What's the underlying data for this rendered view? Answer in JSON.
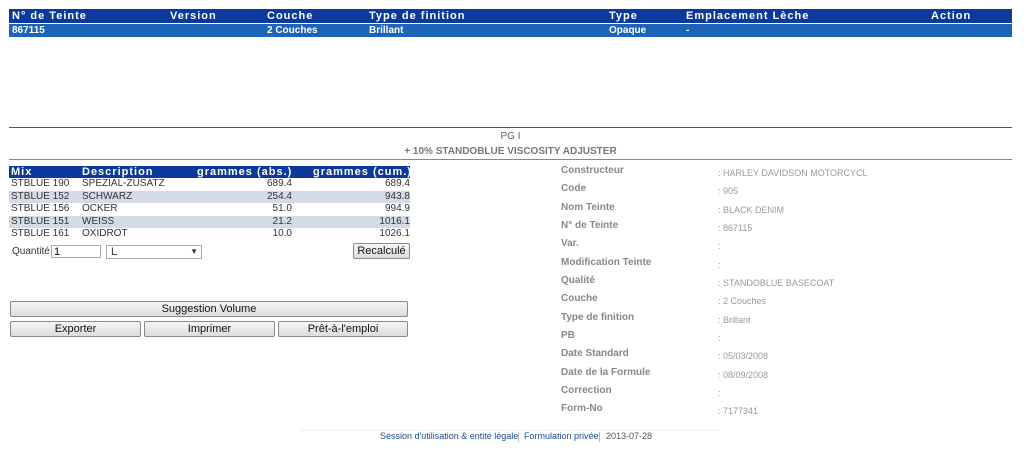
{
  "top_table": {
    "headers": [
      "N° de Teinte",
      "Version",
      "Couche",
      "Type de finition",
      "Type",
      "Emplacement Lèche",
      "Action"
    ],
    "row": {
      "teinte": "867115",
      "version": "",
      "couche": "2 Couches",
      "finition": "Brillant",
      "type": "Opaque",
      "emplacement": "-",
      "action": ""
    }
  },
  "formula": {
    "line1": "PG I",
    "line2": "+ 10% STANDOBLUE VISCOSITY ADJUSTER"
  },
  "mix_table": {
    "headers": [
      "Mix",
      "Description",
      "grammes (abs.)",
      "grammes (cum.)"
    ],
    "rows": [
      {
        "mix": "STBLUE 190",
        "desc": "SPEZIAL-ZUSATZ",
        "abs": "689.4",
        "cum": "689.4"
      },
      {
        "mix": "STBLUE 152",
        "desc": "SCHWARZ",
        "abs": "254.4",
        "cum": "943.8"
      },
      {
        "mix": "STBLUE 156",
        "desc": "OCKER",
        "abs": "51.0",
        "cum": "994.9"
      },
      {
        "mix": "STBLUE 151",
        "desc": "WEISS",
        "abs": "21.2",
        "cum": "1016.1"
      },
      {
        "mix": "STBLUE 161",
        "desc": "OXIDROT",
        "abs": "10.0",
        "cum": "1026.1"
      }
    ]
  },
  "quantity": {
    "label": "Quantité",
    "value": "1",
    "unit": "L"
  },
  "buttons": {
    "recalc": "Recalculé",
    "suggestion": "Suggestion Volume",
    "export": "Exporter",
    "print": "Imprimer",
    "ready": "Prêt-à-l'emploi"
  },
  "info": [
    {
      "label": "Constructeur",
      "value": ": HARLEY DAVIDSON MOTORCYCL"
    },
    {
      "label": "Code",
      "value": ": 905"
    },
    {
      "label": "Nom Teinte",
      "value": ": BLACK DENIM"
    },
    {
      "label": "N° de Teinte",
      "value": ": 867115"
    },
    {
      "label": "Var.",
      "value": ":"
    },
    {
      "label": "Modification Teinte",
      "value": ":"
    },
    {
      "label": "Qualité",
      "value": ": STANDOBLUE BASECOAT"
    },
    {
      "label": "Couche",
      "value": ": 2 Couches"
    },
    {
      "label": "Type de finition",
      "value": ": Brillant"
    },
    {
      "label": "PB",
      "value": ":"
    },
    {
      "label": "Date Standard",
      "value": ": 05/03/2008"
    },
    {
      "label": "Date de la Formule",
      "value": ": 08/09/2008"
    },
    {
      "label": "Correction",
      "value": ":"
    },
    {
      "label": "Form-No",
      "value": ": 7177341"
    }
  ],
  "footer": {
    "session": "Session d'utilisation & entité légale",
    "private": "Formulation privée",
    "date": "2013-07-28"
  }
}
